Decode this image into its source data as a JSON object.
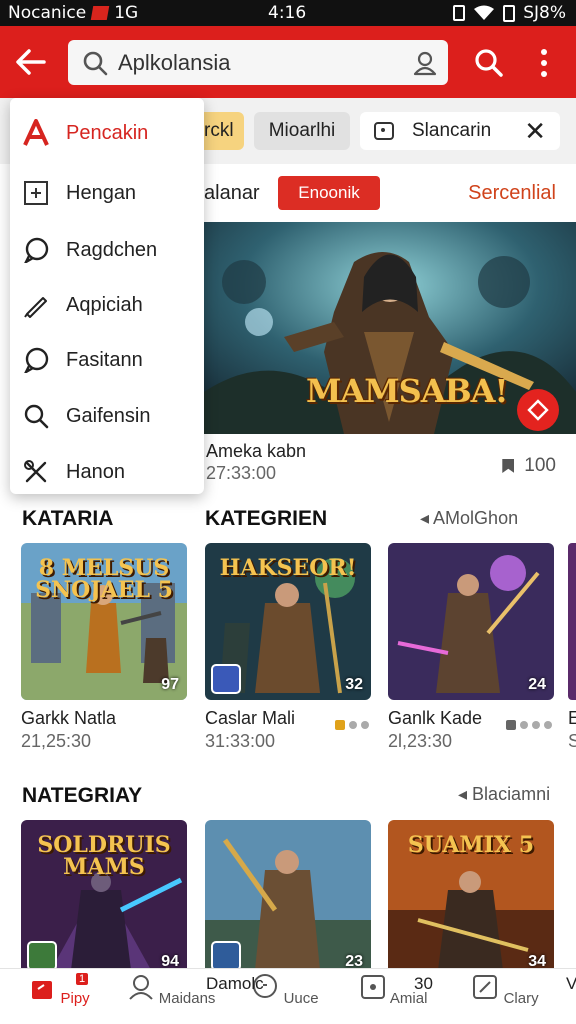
{
  "status_bar": {
    "carrier": "Nocanice",
    "network": "1G",
    "time": "4:16",
    "right": "SJ8%"
  },
  "header": {
    "search_value": "Aplkolansia"
  },
  "chips": {
    "chip1": "rckl",
    "chip2": "Mioarlhi",
    "chip3": "Slancarin"
  },
  "subtabs": {
    "tab1": "alanar",
    "tab2": "Enoonik",
    "tab3": "Sercenlial"
  },
  "featured": {
    "title": "MAMSABA!",
    "name": "Ameka kabn",
    "time": "27:33:00",
    "count": "100"
  },
  "menu": {
    "items": [
      {
        "label": "Pencakin",
        "icon": "brand-a-icon"
      },
      {
        "label": "Hengan",
        "icon": "square-sparkle-icon"
      },
      {
        "label": "Ragdchen",
        "icon": "chat-bubble-icon"
      },
      {
        "label": "Aqpiciah",
        "icon": "pencil-icon"
      },
      {
        "label": "Fasitann",
        "icon": "chat-bubble-icon"
      },
      {
        "label": "Gaifensin",
        "icon": "search-icon"
      },
      {
        "label": "Hanon",
        "icon": "tools-icon"
      }
    ]
  },
  "section1": {
    "title_left": "KATARIA",
    "title_mid": "KATEGRIEN",
    "link": "AMolGhon",
    "cards": [
      {
        "thumb_title": "8 MELSUS SNOJAEL 5",
        "badge": "97",
        "name": "Garkk Natla",
        "time": "21,25:30"
      },
      {
        "thumb_title": "HAKSEOR!",
        "badge": "32",
        "name": "Caslar Mali",
        "time": "31:33:00"
      },
      {
        "thumb_title": "",
        "badge": "24",
        "name": "Ganlk Kade",
        "time": "2l,23:30"
      }
    ],
    "partial": {
      "name": "E",
      "time": "S"
    }
  },
  "section2": {
    "title": "NATEGRIAY",
    "link": "Blaciamni",
    "cards": [
      {
        "thumb_title": "SOLDRUIS MAMS",
        "badge": "94"
      },
      {
        "thumb_title": "",
        "badge": "23"
      },
      {
        "thumb_title": "SUAMIX 5",
        "badge": "34"
      }
    ]
  },
  "bottom_nav": {
    "items": [
      {
        "label": "Pipy",
        "badge": "1"
      },
      {
        "label": "Maidans"
      },
      {
        "label": "Uuce"
      },
      {
        "label": "Amial"
      },
      {
        "label": "Clary"
      }
    ],
    "floating_label": "Damolc",
    "floating_count": "30",
    "partial": "V"
  },
  "colors": {
    "brand_red": "#dc1f1c",
    "accent_orange": "#d0431b",
    "chip_yellow": "#f6d37f"
  }
}
